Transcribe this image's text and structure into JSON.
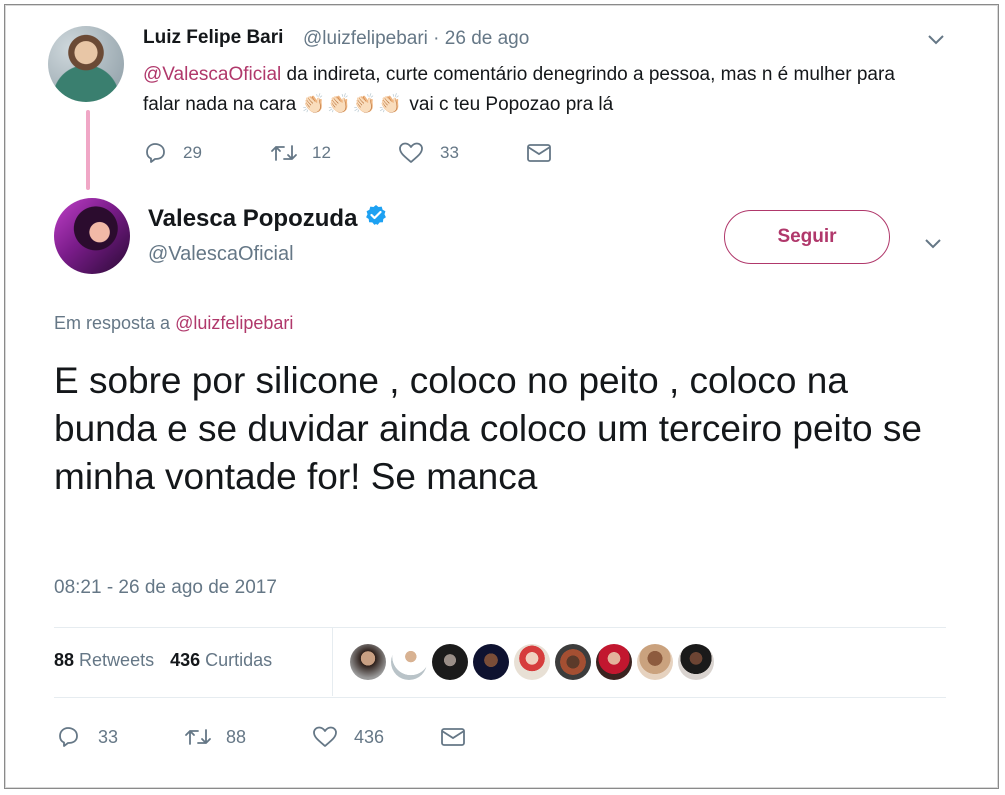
{
  "parent": {
    "name": "Luiz Felipe Bari",
    "meta": "@luizfelipebari · 26 de ago",
    "mention": "@ValescaOficial",
    "text_a": " da indireta, curte comentário denegrindo a pessoa, mas n é mulher para falar nada na cara ",
    "claps": "👏🏻👏🏻👏🏻👏🏻",
    "text_b": " vai c teu Popozao pra lá",
    "replies": "29",
    "retweets": "12",
    "likes": "33"
  },
  "tweet": {
    "name": "Valesca Popozuda",
    "handle": "@ValescaOficial",
    "follow_label": "Seguir",
    "reply_prefix": "Em resposta a ",
    "reply_handle": "@luizfelipebari",
    "body": "E sobre por silicone , coloco no peito , coloco na bunda e se duvidar ainda coloco um terceiro peito se minha vontade for! Se manca",
    "timestamp": "08:21 - 26 de ago de 2017",
    "retweet_count": "88",
    "retweet_label": "Retweets",
    "like_count": "436",
    "like_label": "Curtidas",
    "replies": "33",
    "retweets": "88",
    "likes": "436"
  },
  "colors": {
    "accent": "#b0386b",
    "muted": "#657786",
    "thread_line": "#f0a7c6",
    "verified": "#1da1f2"
  },
  "icons": [
    "chevron-down-icon",
    "reply-icon",
    "retweet-icon",
    "heart-icon",
    "mail-icon",
    "verified-badge-icon"
  ]
}
